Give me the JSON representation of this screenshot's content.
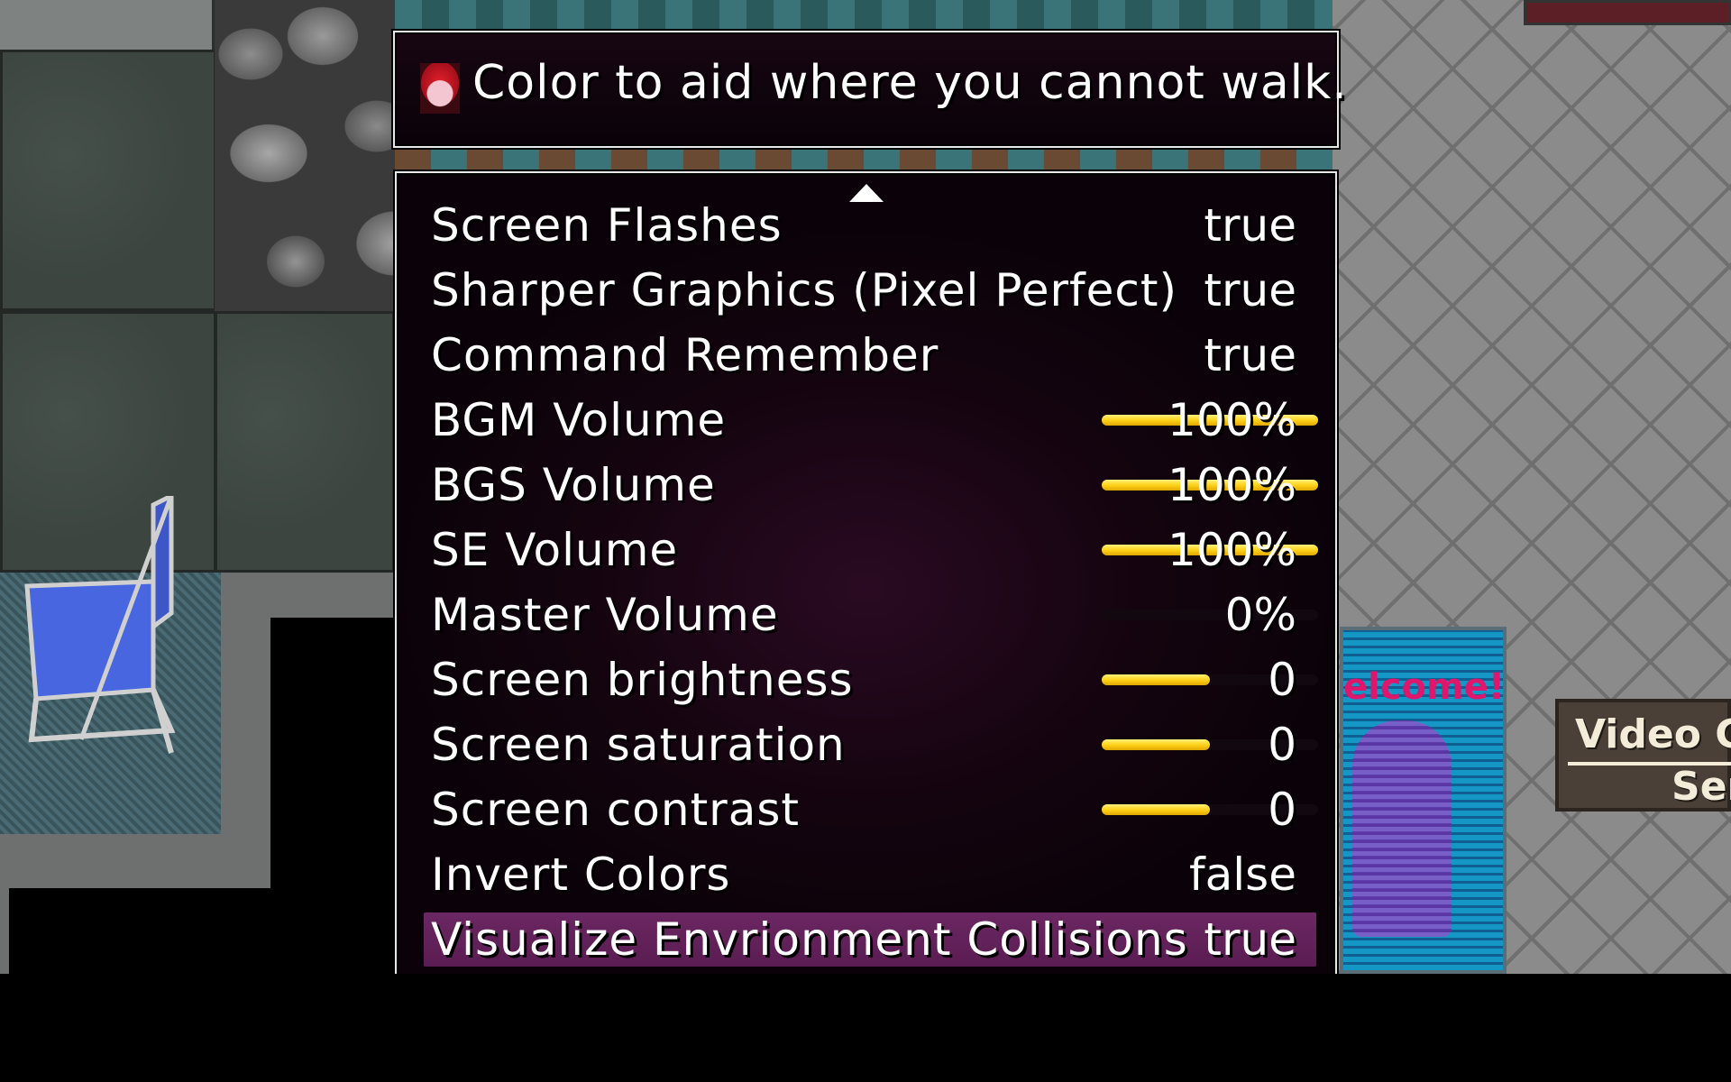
{
  "help": {
    "text": "Color to aid where you cannot walk.",
    "icon": "red-haired-character-portrait-icon"
  },
  "options": [
    {
      "label": "Screen Flashes",
      "value": "true"
    },
    {
      "label": "Sharper Graphics (Pixel Perfect)",
      "value": "true"
    },
    {
      "label": "Command Remember",
      "value": "true"
    },
    {
      "label": "BGM Volume",
      "value": "100%",
      "level": 1.0
    },
    {
      "label": "BGS Volume",
      "value": "100%",
      "level": 1.0
    },
    {
      "label": "SE Volume",
      "value": "100%",
      "level": 1.0
    },
    {
      "label": "Master Volume",
      "value": "0%",
      "level": 0.0
    },
    {
      "label": "Screen brightness",
      "value": "0",
      "level": 0.5
    },
    {
      "label": "Screen saturation",
      "value": "0",
      "level": 0.5
    },
    {
      "label": "Screen contrast",
      "value": "0",
      "level": 0.5
    },
    {
      "label": "Invert Colors",
      "value": "false"
    },
    {
      "label": "Visualize Envrionment Collisions",
      "value": "true",
      "selected": true
    }
  ],
  "scene": {
    "poster_text": "elcome!",
    "sign_line1": "Video G",
    "sign_line2": "Ser"
  },
  "colors": {
    "gauge": "#ffd21a",
    "selected_row": "#6b2762",
    "window_border": "#e8e8e8"
  }
}
